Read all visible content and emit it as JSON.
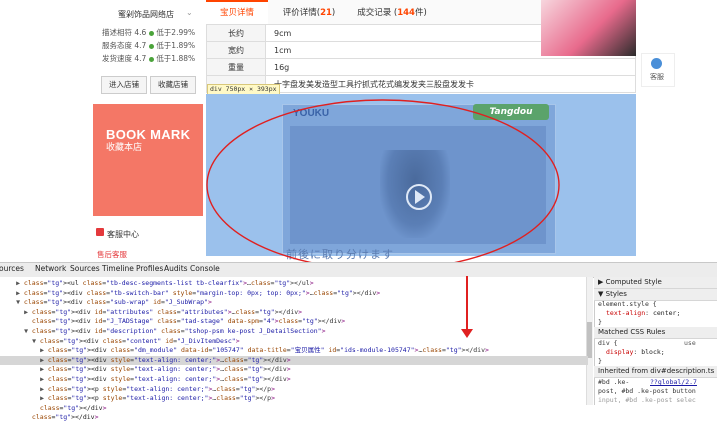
{
  "shop": {
    "name": "蜜剁饰品网络店",
    "ratings": [
      {
        "label": "描述相符 4.6",
        "compare": "低于2.99%"
      },
      {
        "label": "服务态度 4.7",
        "compare": "低于1.89%"
      },
      {
        "label": "发货速度 4.7",
        "compare": "低于1.88%"
      }
    ],
    "enter_button": "进入店铺",
    "favorite_button": "收藏店铺",
    "bookmark_title": "BOOK MARK",
    "bookmark_sub": "收藏本店",
    "service_title": "客服中心",
    "service_name": "售后客服"
  },
  "tabs": [
    {
      "label": "宝贝详情",
      "count": "",
      "active": true
    },
    {
      "label": "评价详情(",
      "count": "21",
      "suffix": ")"
    },
    {
      "label": "成交记录 (",
      "count": "144",
      "suffix": "件)"
    }
  ],
  "attributes": [
    {
      "key": "长约",
      "value": "9cm"
    },
    {
      "key": "宽约",
      "value": "1cm"
    },
    {
      "key": "重量",
      "value": "16g"
    },
    {
      "key": "",
      "value": "十字盘发美发造型工具拧抓式花式编发发夹三股盘发发卡"
    }
  ],
  "dimension_label": "div 750px × 393px",
  "float_service": "客服",
  "video": {
    "brand": "YOUKU",
    "watermark": "Tangdou",
    "caption": "前後に取り分けます"
  },
  "devtools": {
    "tabs": [
      "ources",
      "Network",
      "Sources",
      "Timeline",
      "Profiles",
      "Audits",
      "Console"
    ],
    "lines": [
      {
        "indent": 2,
        "tw": "▶",
        "html": "<ul class=\"tb-desc-segments-list tb-clearfix\">…</ul>",
        "sel": false
      },
      {
        "indent": 2,
        "tw": "▶",
        "html": "<div class=\"tb-switch-bar\" style=\"margin-top: 0px; top: 0px;\">…</div>",
        "sel": false
      },
      {
        "indent": 2,
        "tw": "▼",
        "html": "<div class=\"sub-wrap\" id=\"J_SubWrap\">",
        "sel": false
      },
      {
        "indent": 3,
        "tw": "▶",
        "html": "<div id=\"attributes\" class=\"attributes\">…</div>",
        "sel": false
      },
      {
        "indent": 3,
        "tw": "",
        "html": "<div id=\"J_TADStage\" class=\"tad-stage\" data-spm=\"4\"></div>",
        "sel": false
      },
      {
        "indent": 3,
        "tw": "▼",
        "html": "<div id=\"description\" class=\"tshop-psm ke-post J_DetailSection\">",
        "sel": false
      },
      {
        "indent": 4,
        "tw": "▼",
        "html": "<div class=\"content\" id=\"J_DivItemDesc\">",
        "sel": false
      },
      {
        "indent": 5,
        "tw": "▶",
        "html": "<div class=\"dm_module\" data-id=\"105747\" data-title=\"宝贝属性\" id=\"ids-module-105747\">…</div>",
        "sel": false
      },
      {
        "indent": 5,
        "tw": "▶",
        "html": "<div style=\"text-align: center;\">…</div>",
        "sel": true
      },
      {
        "indent": 5,
        "tw": "▶",
        "html": "<div style=\"text-align: center;\">…</div>",
        "sel": false
      },
      {
        "indent": 5,
        "tw": "▶",
        "html": "<div style=\"text-align: center;\">…</div>",
        "sel": false
      },
      {
        "indent": 5,
        "tw": "▶",
        "html": "<p style=\"text-align: center;\">…</p>",
        "sel": false
      },
      {
        "indent": 5,
        "tw": "▶",
        "html": "<p style=\"text-align: center;\">…</p>",
        "sel": false
      },
      {
        "indent": 4,
        "tw": "",
        "html": "</div>",
        "sel": false
      },
      {
        "indent": 3,
        "tw": "",
        "html": "</div>",
        "sel": false
      }
    ],
    "side": {
      "computed": "Computed Style",
      "styles": "Styles",
      "element_style": "element.style {",
      "prop1": "text-align",
      "val1": "center;",
      "matched": "Matched CSS Rules",
      "rule_sel": "div {",
      "rule_src": "use",
      "prop2": "display",
      "val2": "block;",
      "inherited": "Inherited from div#description.ts",
      "bd_sel": "#bd .ke-",
      "bd_src": "??global/2.7",
      "bd_line2": "post, #bd .ke-post button",
      "bd_line3": "input, #bd .ke-post selec"
    }
  },
  "colors": {
    "accent": "#ff4400",
    "highlight": "#9bc1ec",
    "annotation": "#e02020"
  }
}
